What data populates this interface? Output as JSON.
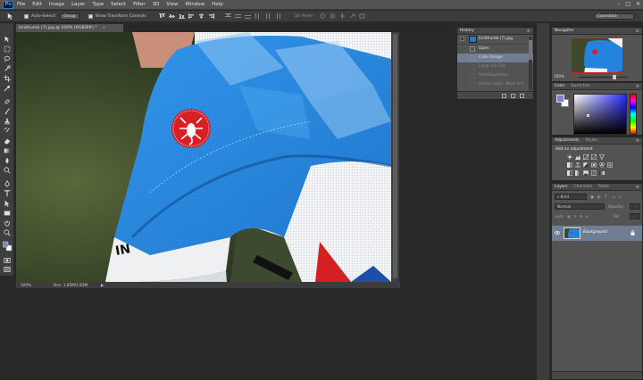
{
  "app": {
    "logo_text": "Ps"
  },
  "menubar": {
    "items": [
      "File",
      "Edit",
      "Image",
      "Layer",
      "Type",
      "Select",
      "Filter",
      "3D",
      "View",
      "Window",
      "Help"
    ],
    "window_controls": [
      "–",
      "□",
      "✕"
    ]
  },
  "options_bar": {
    "tool_icon": "move-tool-icon",
    "auto_select_label": "Auto-Select:",
    "auto_select_value": "Group",
    "show_transform_label": "Show Transform Controls",
    "mode_3d_label": "3D Mode:",
    "workspace": "Essentials"
  },
  "document": {
    "tab_title": "limithumb (7).jpg @ 100% (RGB/8#) *",
    "zoom": "100%",
    "doc_size": "Doc: 1.82M/1.82M"
  },
  "history": {
    "tabs": [
      "History"
    ],
    "snapshot_label": "limithumb (7).jpg",
    "steps": [
      {
        "label": "Open",
        "state": "normal"
      },
      {
        "label": "Color Range",
        "state": "selected"
      },
      {
        "label": "Layer Via Cut",
        "state": "dimmed"
      },
      {
        "label": "Hue/Saturation",
        "state": "dimmed"
      },
      {
        "label": "Delete Layer (New Art)",
        "state": "dimmed"
      }
    ]
  },
  "navigator": {
    "tabs": [
      "Navigator"
    ],
    "zoom": "100%"
  },
  "color_panel": {
    "tabs": [
      "Color",
      "Swatches"
    ],
    "foreground": "#7c86c6",
    "background": "#ffffff"
  },
  "adjustments": {
    "tabs": [
      "Adjustments",
      "Styles"
    ],
    "label": "Add an adjustment"
  },
  "layers": {
    "tabs": [
      "Layers",
      "Channels",
      "Paths"
    ],
    "filter_label": "Kind",
    "blend_mode": "Normal",
    "opacity_label": "Opacity:",
    "lock_label": "Lock:",
    "fill_label": "Fill:",
    "layer_name": "Background"
  },
  "colors": {
    "chrome": "#535353",
    "workspace": "#282828",
    "selection": "#6f7e92",
    "jersey_blue": "#1f7fd8"
  }
}
